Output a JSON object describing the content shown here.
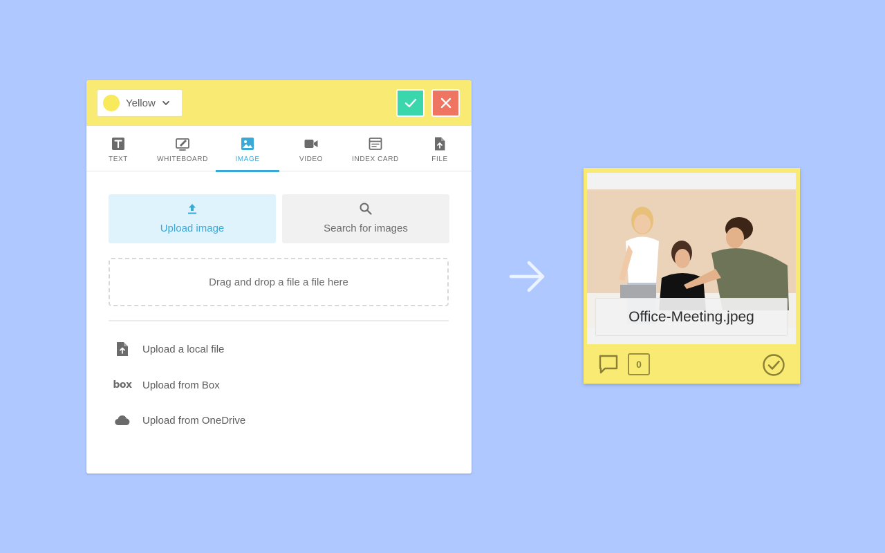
{
  "editor": {
    "color_select": {
      "label": "Yellow",
      "swatch": "#f8ea5c"
    },
    "header_color": "#f8ea72",
    "confirm_color": "#3ad6ac",
    "cancel_color": "#ef7563",
    "tabs": [
      {
        "label": "TEXT",
        "icon": "text-icon"
      },
      {
        "label": "WHITEBOARD",
        "icon": "whiteboard-icon"
      },
      {
        "label": "IMAGE",
        "icon": "image-icon",
        "active": true
      },
      {
        "label": "VIDEO",
        "icon": "video-icon"
      },
      {
        "label": "INDEX CARD",
        "icon": "index-card-icon"
      },
      {
        "label": "FILE",
        "icon": "file-icon"
      }
    ],
    "accent": "#3aa9d8",
    "upload_image_label": "Upload image",
    "search_images_label": "Search for images",
    "dropzone_text": "Drag and drop a file a file here",
    "upload_options": [
      {
        "label": "Upload a local file",
        "icon": "file-upload-icon"
      },
      {
        "label": "Upload from Box",
        "icon": "box-logo-icon",
        "logo_text": "box"
      },
      {
        "label": "Upload from OneDrive",
        "icon": "cloud-icon"
      }
    ]
  },
  "card": {
    "color": "#f8ea72",
    "caption": "Office-Meeting.jpeg",
    "comment_count": "0"
  }
}
